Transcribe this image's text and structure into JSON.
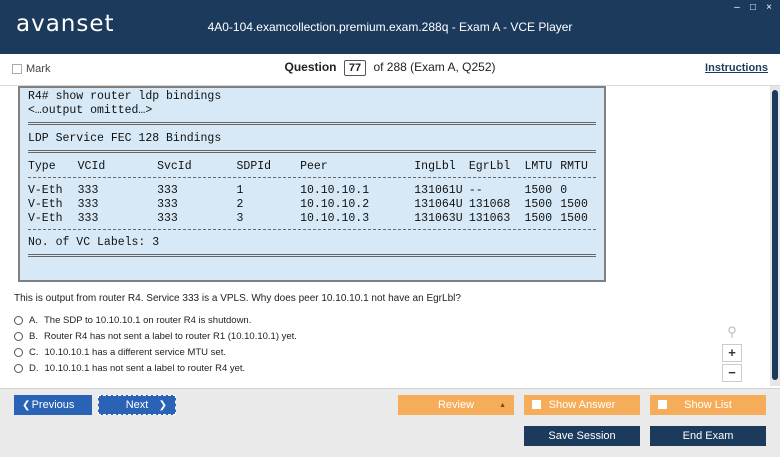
{
  "window": {
    "logo": "avanset",
    "title": "4A0-104.examcollection.premium.exam.288q - Exam A - VCE Player",
    "controls": [
      "–",
      "□",
      "×"
    ]
  },
  "header": {
    "mark_label": "Mark",
    "question_label": "Question",
    "question_number": "77",
    "question_total": "of 288 (Exam A, Q252)",
    "instructions_label": "Instructions"
  },
  "exhibit": {
    "command": "R4# show router ldp bindings",
    "omitted": "<…output omitted…>",
    "heading": "LDP Service FEC 128 Bindings",
    "columns": [
      "Type",
      "VCId",
      "SvcId",
      "SDPId",
      "Peer",
      "IngLbl",
      "EgrLbl",
      "LMTU",
      "RMTU"
    ],
    "rows": [
      [
        "V-Eth",
        "333",
        "333",
        "1",
        "10.10.10.1",
        "131061U",
        "--",
        "1500",
        "0"
      ],
      [
        "V-Eth",
        "333",
        "333",
        "2",
        "10.10.10.2",
        "131064U",
        "131068",
        "1500",
        "1500"
      ],
      [
        "V-Eth",
        "333",
        "333",
        "3",
        "10.10.10.3",
        "131063U",
        "131063",
        "1500",
        "1500"
      ]
    ],
    "footer": "No. of VC Labels: 3"
  },
  "question": {
    "text": "This is output from router R4. Service 333 is a VPLS. Why does peer 10.10.10.1 not have an EgrLbl?",
    "answers": [
      {
        "letter": "A.",
        "text": "The SDP to 10.10.10.1 on router R4 is shutdown."
      },
      {
        "letter": "B.",
        "text": "Router R4 has not sent a label to router R1 (10.10.10.1) yet."
      },
      {
        "letter": "C.",
        "text": "10.10.10.1 has a different service MTU set."
      },
      {
        "letter": "D.",
        "text": "10.10.10.1 has not sent a label to router R4 yet."
      }
    ]
  },
  "zoom": {
    "plus": "+",
    "minus": "−"
  },
  "nav": {
    "previous": "Previous",
    "next": "Next",
    "review": "Review",
    "show_answer": "Show Answer",
    "show_list": "Show List",
    "save_session": "Save Session",
    "end_exam": "End Exam"
  },
  "colors": {
    "titlebar": "#1c3a5c",
    "nav_blue": "#2a63b5",
    "orange": "#f5ad5a",
    "exhibit_bg": "#d7e9f7"
  }
}
